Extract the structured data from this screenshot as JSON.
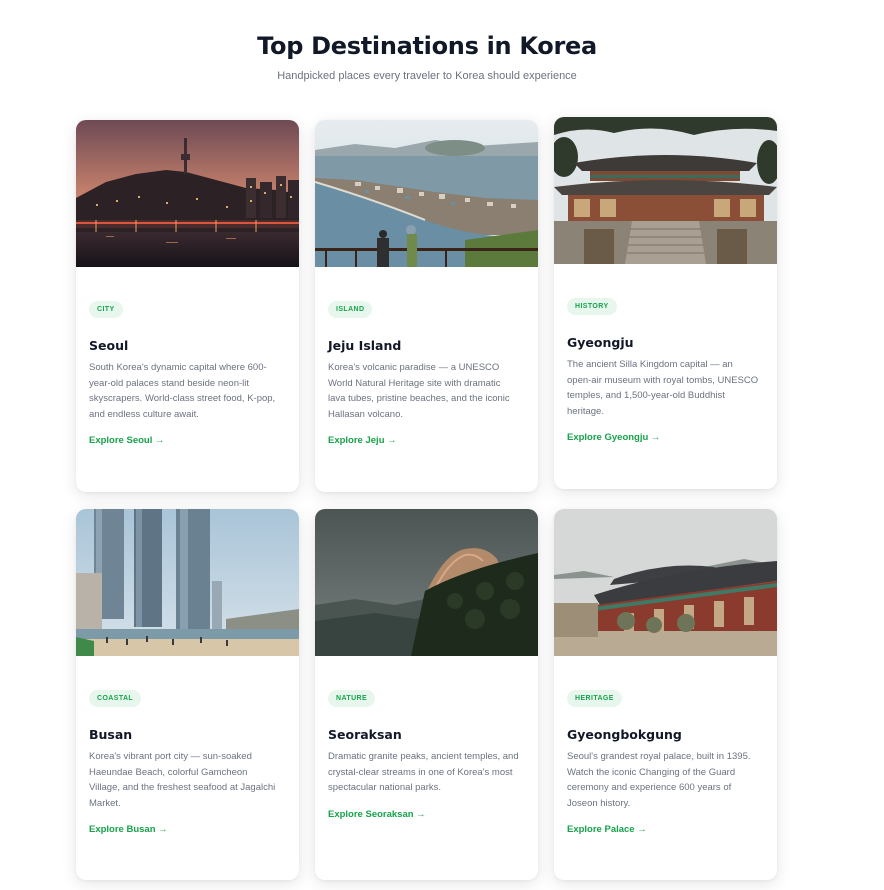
{
  "header": {
    "title": "Top Destinations in Korea",
    "subtitle": "Handpicked places every traveler to Korea should experience"
  },
  "cards": [
    {
      "badge": "CITY",
      "name": "Seoul",
      "description": "South Korea's dynamic capital where 600-year-old palaces stand beside neon-lit skyscrapers. World-class street food, K-pop, and endless culture await.",
      "link": "Explore Seoul →"
    },
    {
      "badge": "ISLAND",
      "name": "Jeju Island",
      "description": "Korea's volcanic paradise — a UNESCO World Natural Heritage site with dramatic lava tubes, pristine beaches, and the iconic Hallasan volcano.",
      "link": "Explore Jeju →"
    },
    {
      "badge": "HISTORY",
      "name": "Gyeongju",
      "description": "The ancient Silla Kingdom capital — an open-air museum with royal tombs, UNESCO temples, and 1,500-year-old Buddhist heritage.",
      "link": "Explore Gyeongju →"
    },
    {
      "badge": "COASTAL",
      "name": "Busan",
      "description": "Korea's vibrant port city — sun-soaked Haeundae Beach, colorful Gamcheon Village, and the freshest seafood at Jagalchi Market.",
      "link": "Explore Busan →"
    },
    {
      "badge": "NATURE",
      "name": "Seoraksan",
      "description": "Dramatic granite peaks, ancient temples, and crystal-clear streams in one of Korea's most spectacular national parks.",
      "link": "Explore Seoraksan →"
    },
    {
      "badge": "HERITAGE",
      "name": "Gyeongbokgung",
      "description": "Seoul's grandest royal palace, built in 1395. Watch the iconic Changing of the Guard ceremony and experience 600 years of Joseon history.",
      "link": "Explore Palace →"
    }
  ],
  "colors": {
    "accent": "#16a34a",
    "badge_bg": "#e8f7ee",
    "title": "#111827",
    "body_text": "#6b7280"
  }
}
